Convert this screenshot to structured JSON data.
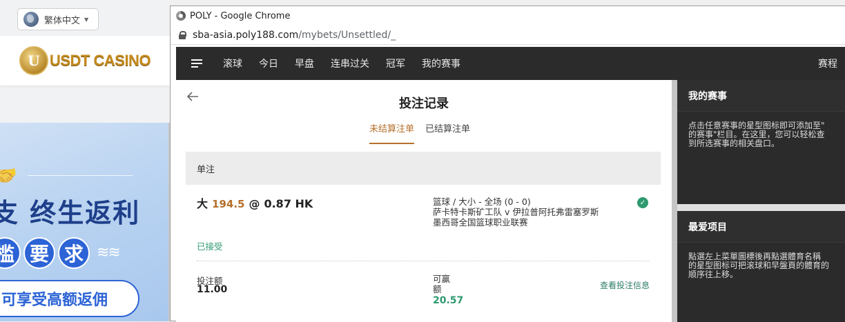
{
  "casino": {
    "language": "繁体中文",
    "logo_letter": "U",
    "logo_text": "USDT CASINO",
    "banner_headline": "支 终生返利",
    "banner_req": [
      "槛",
      "要",
      "求"
    ],
    "banner_pill": "可享受高额返佣"
  },
  "browser": {
    "title": "POLY - Google Chrome",
    "url_host": "sba-asia.poly188.com",
    "url_path": "/mybets/Unsettled/_"
  },
  "nav": {
    "items": [
      "滚球",
      "今日",
      "早盘",
      "连串过关",
      "冠军",
      "我的赛事"
    ],
    "right": "赛程"
  },
  "main": {
    "title": "投注记录",
    "tabs": [
      {
        "label": "未结算注单",
        "active": true
      },
      {
        "label": "已结算注单",
        "active": false
      }
    ],
    "section_label": "单注",
    "bet": {
      "pick": "大",
      "line": "194.5",
      "at": "@",
      "odds": "0.87 HK",
      "market": "篮球 / 大小 - 全场 (0 - 0)",
      "teams": "萨卡特卡斯矿工队 v 伊拉普阿托弗雷塞罗斯",
      "league": "墨西哥全国篮球职业联赛",
      "status": "已接受",
      "stake_label": "投注额",
      "stake_value": "11.00",
      "win_label": "可赢额",
      "win_value": "20.57",
      "detail_link": "查看投注信息"
    }
  },
  "side": {
    "fav_title": "我的赛事",
    "fav_body": [
      "点击任意赛事的星型图标即可添加至\"",
      "的赛事\"栏目。在这里，您可以轻松查",
      "到所选赛事的相关盘口。"
    ],
    "like_title": "最爱项目",
    "like_body": [
      "點選左上菜單圖標後再點選體育名稱",
      "的星型图标可把滚球和早盤頁的體育的",
      "顺序往上移。"
    ]
  },
  "colors": {
    "accent": "#b5702b",
    "success": "#2e9a6f",
    "nav_bg": "#2b2b2b"
  }
}
